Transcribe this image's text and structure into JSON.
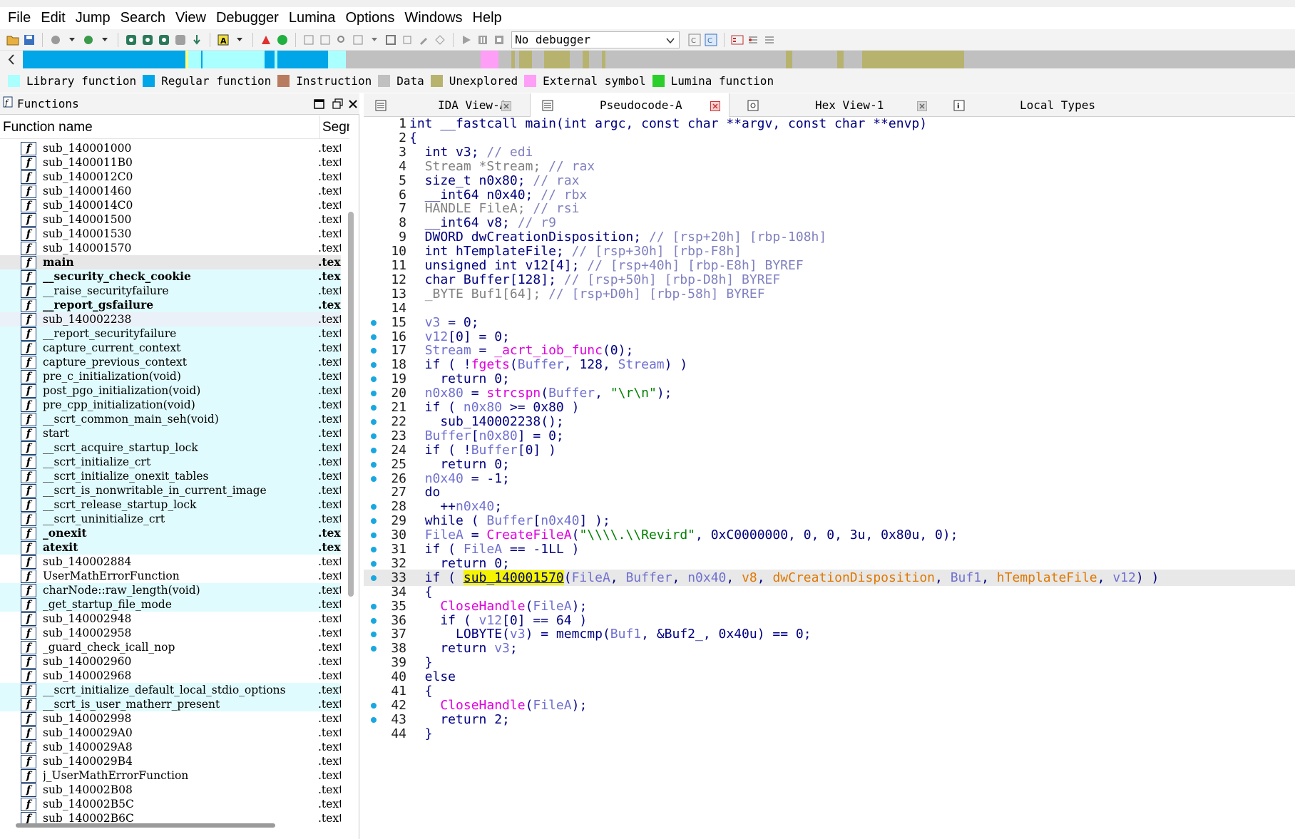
{
  "menu": [
    "File",
    "Edit",
    "Jump",
    "Search",
    "View",
    "Debugger",
    "Lumina",
    "Options",
    "Windows",
    "Help"
  ],
  "toolbar": {
    "debugger_select": "No debugger",
    "icons": [
      "open-file-icon",
      "save-icon",
      "back-icon",
      "forward-icon",
      "jump-icon",
      "search-icon",
      "search-text-icon",
      "search-binary-icon",
      "search-next-icon",
      "text-mode-icon",
      "create-function-icon",
      "start-icon",
      "lumina-icon",
      "run-icon",
      "pause-icon",
      "stop-icon",
      "graph-icon",
      "list-icon"
    ]
  },
  "legend": [
    {
      "label": "Library function",
      "color": "#aaffff"
    },
    {
      "label": "Regular function",
      "color": "#00a6e8"
    },
    {
      "label": "Instruction",
      "color": "#b97b60"
    },
    {
      "label": "Data",
      "color": "#c0c0c0"
    },
    {
      "label": "Unexplored",
      "color": "#b7b36f"
    },
    {
      "label": "External symbol",
      "color": "#ff9ef7"
    },
    {
      "label": "Lumina function",
      "color": "#2bcf2b"
    }
  ],
  "nav_segments": [
    {
      "start": 0.0,
      "end": 0.128,
      "color": "#00a6e8"
    },
    {
      "start": 0.128,
      "end": 0.13,
      "color": "#ffff80"
    },
    {
      "start": 0.13,
      "end": 0.14,
      "color": "#aaffff"
    },
    {
      "start": 0.14,
      "end": 0.141,
      "color": "#00a6e8"
    },
    {
      "start": 0.141,
      "end": 0.19,
      "color": "#aaffff"
    },
    {
      "start": 0.19,
      "end": 0.198,
      "color": "#00a6e8"
    },
    {
      "start": 0.198,
      "end": 0.2,
      "color": "#aaffff"
    },
    {
      "start": 0.2,
      "end": 0.24,
      "color": "#00a6e8"
    },
    {
      "start": 0.24,
      "end": 0.254,
      "color": "#aaffff"
    },
    {
      "start": 0.254,
      "end": 0.36,
      "color": "#c0c0c0"
    },
    {
      "start": 0.36,
      "end": 0.374,
      "color": "#ff9ef7"
    },
    {
      "start": 0.374,
      "end": 0.384,
      "color": "#c0c0c0"
    },
    {
      "start": 0.384,
      "end": 0.387,
      "color": "#b7b36f"
    },
    {
      "start": 0.387,
      "end": 0.39,
      "color": "#c0c0c0"
    },
    {
      "start": 0.39,
      "end": 0.4,
      "color": "#b7b36f"
    },
    {
      "start": 0.4,
      "end": 0.41,
      "color": "#c0c0c0"
    },
    {
      "start": 0.41,
      "end": 0.43,
      "color": "#b7b36f"
    },
    {
      "start": 0.43,
      "end": 0.44,
      "color": "#c0c0c0"
    },
    {
      "start": 0.44,
      "end": 0.445,
      "color": "#b7b36f"
    },
    {
      "start": 0.445,
      "end": 0.455,
      "color": "#c0c0c0"
    },
    {
      "start": 0.455,
      "end": 0.458,
      "color": "#b7b36f"
    },
    {
      "start": 0.458,
      "end": 0.6,
      "color": "#c0c0c0"
    },
    {
      "start": 0.6,
      "end": 0.605,
      "color": "#b7b36f"
    },
    {
      "start": 0.605,
      "end": 0.64,
      "color": "#c0c0c0"
    },
    {
      "start": 0.64,
      "end": 0.645,
      "color": "#b7b36f"
    },
    {
      "start": 0.645,
      "end": 0.66,
      "color": "#c0c0c0"
    },
    {
      "start": 0.66,
      "end": 0.74,
      "color": "#b7b36f"
    },
    {
      "start": 0.74,
      "end": 1.0,
      "color": "#c0c0c0"
    }
  ],
  "functions_panel": {
    "title": "Functions",
    "col_name": "Function name",
    "col_seg": "Segment",
    "rows": [
      {
        "name": "sub_140001000",
        "seg": ".text",
        "kind": "reg"
      },
      {
        "name": "sub_1400011B0",
        "seg": ".text",
        "kind": "reg"
      },
      {
        "name": "sub_1400012C0",
        "seg": ".text",
        "kind": "reg"
      },
      {
        "name": "sub_140001460",
        "seg": ".text",
        "kind": "reg"
      },
      {
        "name": "sub_1400014C0",
        "seg": ".text",
        "kind": "reg"
      },
      {
        "name": "sub_140001500",
        "seg": ".text",
        "kind": "reg"
      },
      {
        "name": "sub_140001530",
        "seg": ".text",
        "kind": "reg"
      },
      {
        "name": "sub_140001570",
        "seg": ".text",
        "kind": "reg"
      },
      {
        "name": "main",
        "seg": ".text",
        "kind": "sel",
        "bold": true
      },
      {
        "name": "__security_check_cookie",
        "seg": ".text",
        "kind": "lib",
        "bold": true
      },
      {
        "name": "__raise_securityfailure",
        "seg": ".text",
        "kind": "lib"
      },
      {
        "name": "__report_gsfailure",
        "seg": ".text",
        "kind": "lib",
        "bold": true
      },
      {
        "name": "sub_140002238",
        "seg": ".text",
        "kind": "hl"
      },
      {
        "name": "__report_securityfailure",
        "seg": ".text",
        "kind": "lib"
      },
      {
        "name": "capture_current_context",
        "seg": ".text",
        "kind": "lib"
      },
      {
        "name": "capture_previous_context",
        "seg": ".text",
        "kind": "lib"
      },
      {
        "name": "pre_c_initialization(void)",
        "seg": ".text",
        "kind": "lib"
      },
      {
        "name": "post_pgo_initialization(void)",
        "seg": ".text",
        "kind": "lib"
      },
      {
        "name": "pre_cpp_initialization(void)",
        "seg": ".text",
        "kind": "lib"
      },
      {
        "name": "__scrt_common_main_seh(void)",
        "seg": ".text",
        "kind": "lib"
      },
      {
        "name": "start",
        "seg": ".text",
        "kind": "lib"
      },
      {
        "name": "__scrt_acquire_startup_lock",
        "seg": ".text",
        "kind": "lib"
      },
      {
        "name": "__scrt_initialize_crt",
        "seg": ".text",
        "kind": "lib"
      },
      {
        "name": "__scrt_initialize_onexit_tables",
        "seg": ".text",
        "kind": "lib"
      },
      {
        "name": "__scrt_is_nonwritable_in_current_image",
        "seg": ".text",
        "kind": "lib"
      },
      {
        "name": "__scrt_release_startup_lock",
        "seg": ".text",
        "kind": "lib"
      },
      {
        "name": "__scrt_uninitialize_crt",
        "seg": ".text",
        "kind": "lib"
      },
      {
        "name": "_onexit",
        "seg": ".text",
        "kind": "lib",
        "bold": true
      },
      {
        "name": "atexit",
        "seg": ".text",
        "kind": "lib",
        "bold": true
      },
      {
        "name": "sub_140002884",
        "seg": ".text",
        "kind": "reg"
      },
      {
        "name": "UserMathErrorFunction",
        "seg": ".text",
        "kind": "reg"
      },
      {
        "name": "charNode::raw_length(void)",
        "seg": ".text",
        "kind": "lib"
      },
      {
        "name": "_get_startup_file_mode",
        "seg": ".text",
        "kind": "lib"
      },
      {
        "name": "sub_140002948",
        "seg": ".text",
        "kind": "reg"
      },
      {
        "name": "sub_140002958",
        "seg": ".text",
        "kind": "reg"
      },
      {
        "name": "_guard_check_icall_nop",
        "seg": ".text",
        "kind": "reg"
      },
      {
        "name": "sub_140002960",
        "seg": ".text",
        "kind": "reg"
      },
      {
        "name": "sub_140002968",
        "seg": ".text",
        "kind": "reg"
      },
      {
        "name": "__scrt_initialize_default_local_stdio_options",
        "seg": ".text",
        "kind": "lib"
      },
      {
        "name": "__scrt_is_user_matherr_present",
        "seg": ".text",
        "kind": "lib"
      },
      {
        "name": "sub_140002998",
        "seg": ".text",
        "kind": "reg"
      },
      {
        "name": "sub_1400029A0",
        "seg": ".text",
        "kind": "reg"
      },
      {
        "name": "sub_1400029A8",
        "seg": ".text",
        "kind": "reg"
      },
      {
        "name": "sub_1400029B4",
        "seg": ".text",
        "kind": "reg"
      },
      {
        "name": "j_UserMathErrorFunction",
        "seg": ".text",
        "kind": "reg"
      },
      {
        "name": "sub_140002B08",
        "seg": ".text",
        "kind": "reg"
      },
      {
        "name": "sub_140002B5C",
        "seg": ".text",
        "kind": "reg"
      },
      {
        "name": "sub_140002B6C",
        "seg": ".text",
        "kind": "reg"
      }
    ]
  },
  "tabs": [
    {
      "label": "IDA View-A",
      "active": false
    },
    {
      "label": "Pseudocode-A",
      "active": true
    },
    {
      "label": "Hex View-1",
      "active": false
    },
    {
      "label": "Local Types",
      "active": false
    }
  ],
  "code": [
    {
      "n": "1",
      "dot": false,
      "html": "int __fastcall main(int argc, const char **argv, const char **envp)"
    },
    {
      "n": "2",
      "dot": false,
      "html": "{"
    },
    {
      "n": "3",
      "dot": false,
      "html": "  int v3; <span class=\"c\">// edi</span>"
    },
    {
      "n": "4",
      "dot": false,
      "html": "  <span class=\"lv\">Stream *Stream;</span> <span class=\"c\">// rax</span>"
    },
    {
      "n": "5",
      "dot": false,
      "html": "  size_t n0x80; <span class=\"c\">// rax</span>"
    },
    {
      "n": "6",
      "dot": false,
      "html": "  __int64 n0x40; <span class=\"c\">// rbx</span>"
    },
    {
      "n": "7",
      "dot": false,
      "html": "  <span class=\"lv\">HANDLE FileA;</span> <span class=\"c\">// rsi</span>"
    },
    {
      "n": "8",
      "dot": false,
      "html": "  __int64 v8; <span class=\"c\">// r9</span>"
    },
    {
      "n": "9",
      "dot": false,
      "html": "  DWORD dwCreationDisposition; <span class=\"c\">// [rsp+20h] [rbp-108h]</span>"
    },
    {
      "n": "10",
      "dot": false,
      "html": "  int hTemplateFile; <span class=\"c\">// [rsp+30h] [rbp-F8h]</span>"
    },
    {
      "n": "11",
      "dot": false,
      "html": "  unsigned int v12[4]; <span class=\"c\">// [rsp+40h] [rbp-E8h] BYREF</span>"
    },
    {
      "n": "12",
      "dot": false,
      "html": "  char Buffer[128]; <span class=\"c\">// [rsp+50h] [rbp-D8h] BYREF</span>"
    },
    {
      "n": "13",
      "dot": false,
      "html": "  <span class=\"lv\">_BYTE Buf1[64];</span> <span class=\"c\">// [rsp+D0h] [rbp-58h] BYREF</span>"
    },
    {
      "n": "14",
      "dot": false,
      "html": ""
    },
    {
      "n": "15",
      "dot": true,
      "html": "  <span class=\"v\">v3</span> = 0;"
    },
    {
      "n": "16",
      "dot": true,
      "html": "  <span class=\"v\">v12</span>[0] = 0;"
    },
    {
      "n": "17",
      "dot": true,
      "html": "  <span class=\"v\">Stream</span> = <span class=\"f\">_acrt_iob_func</span>(0);"
    },
    {
      "n": "18",
      "dot": true,
      "html": "  if ( !<span class=\"f\">fgets</span>(<span class=\"v\">Buffer</span>, 128, <span class=\"v\">Stream</span>) )"
    },
    {
      "n": "19",
      "dot": true,
      "html": "    return 0;"
    },
    {
      "n": "20",
      "dot": true,
      "html": "  <span class=\"v\">n0x80</span> = <span class=\"f\">strcspn</span>(<span class=\"v\">Buffer</span>, <span class=\"s\">\"\\r\\n\"</span>);"
    },
    {
      "n": "21",
      "dot": true,
      "html": "  if ( <span class=\"v\">n0x80</span> &gt;= 0x80 )"
    },
    {
      "n": "22",
      "dot": true,
      "html": "    sub_140002238();"
    },
    {
      "n": "23",
      "dot": true,
      "html": "  <span class=\"v\">Buffer</span>[<span class=\"v\">n0x80</span>] = 0;"
    },
    {
      "n": "24",
      "dot": true,
      "html": "  if ( !<span class=\"v\">Buffer</span>[0] )"
    },
    {
      "n": "25",
      "dot": true,
      "html": "    return 0;"
    },
    {
      "n": "26",
      "dot": true,
      "html": "  <span class=\"v\">n0x40</span> = -1;"
    },
    {
      "n": "27",
      "dot": false,
      "html": "  do"
    },
    {
      "n": "28",
      "dot": true,
      "html": "    ++<span class=\"v\">n0x40</span>;"
    },
    {
      "n": "29",
      "dot": true,
      "html": "  while ( <span class=\"v\">Buffer</span>[<span class=\"v\">n0x40</span>] );"
    },
    {
      "n": "30",
      "dot": true,
      "html": "  <span class=\"v\">FileA</span> = <span class=\"f\">CreateFileA</span>(<span class=\"s\">\"\\\\\\\\.\\\\Revird\"</span>, 0xC0000000, 0, 0, 3u, 0x80u, 0);"
    },
    {
      "n": "31",
      "dot": true,
      "html": "  if ( <span class=\"v\">FileA</span> == -1LL )"
    },
    {
      "n": "32",
      "dot": true,
      "html": "    return 0;"
    },
    {
      "n": "33",
      "dot": true,
      "current": true,
      "html": "  if ( <span class=\"sel-fn\">sub_140001570</span>(<span class=\"v\">FileA</span>, <span class=\"v\">Buffer</span>, <span class=\"v\">n0x40</span>, <span class=\"o\">v8</span>, <span class=\"o\">dwCreationDisposition</span>, <span class=\"v\">Buf1</span>, <span class=\"o\">hTemplateFile</span>, <span class=\"v\">v12</span>) )"
    },
    {
      "n": "34",
      "dot": false,
      "html": "  {"
    },
    {
      "n": "35",
      "dot": true,
      "html": "    <span class=\"f\">CloseHandle</span>(<span class=\"v\">FileA</span>);"
    },
    {
      "n": "36",
      "dot": true,
      "html": "    if ( <span class=\"v\">v12</span>[0] == 64 )"
    },
    {
      "n": "37",
      "dot": true,
      "html": "      LOBYTE(<span class=\"v\">v3</span>) = memcmp(<span class=\"v\">Buf1</span>, &amp;Buf2_, 0x40u) == 0;"
    },
    {
      "n": "38",
      "dot": true,
      "html": "    return <span class=\"v\">v3</span>;"
    },
    {
      "n": "39",
      "dot": false,
      "html": "  }"
    },
    {
      "n": "40",
      "dot": false,
      "html": "  else"
    },
    {
      "n": "41",
      "dot": false,
      "html": "  {"
    },
    {
      "n": "42",
      "dot": true,
      "html": "    <span class=\"f\">CloseHandle</span>(<span class=\"v\">FileA</span>);"
    },
    {
      "n": "43",
      "dot": true,
      "html": "    return 2;"
    },
    {
      "n": "44",
      "dot": false,
      "html": "  }"
    }
  ]
}
